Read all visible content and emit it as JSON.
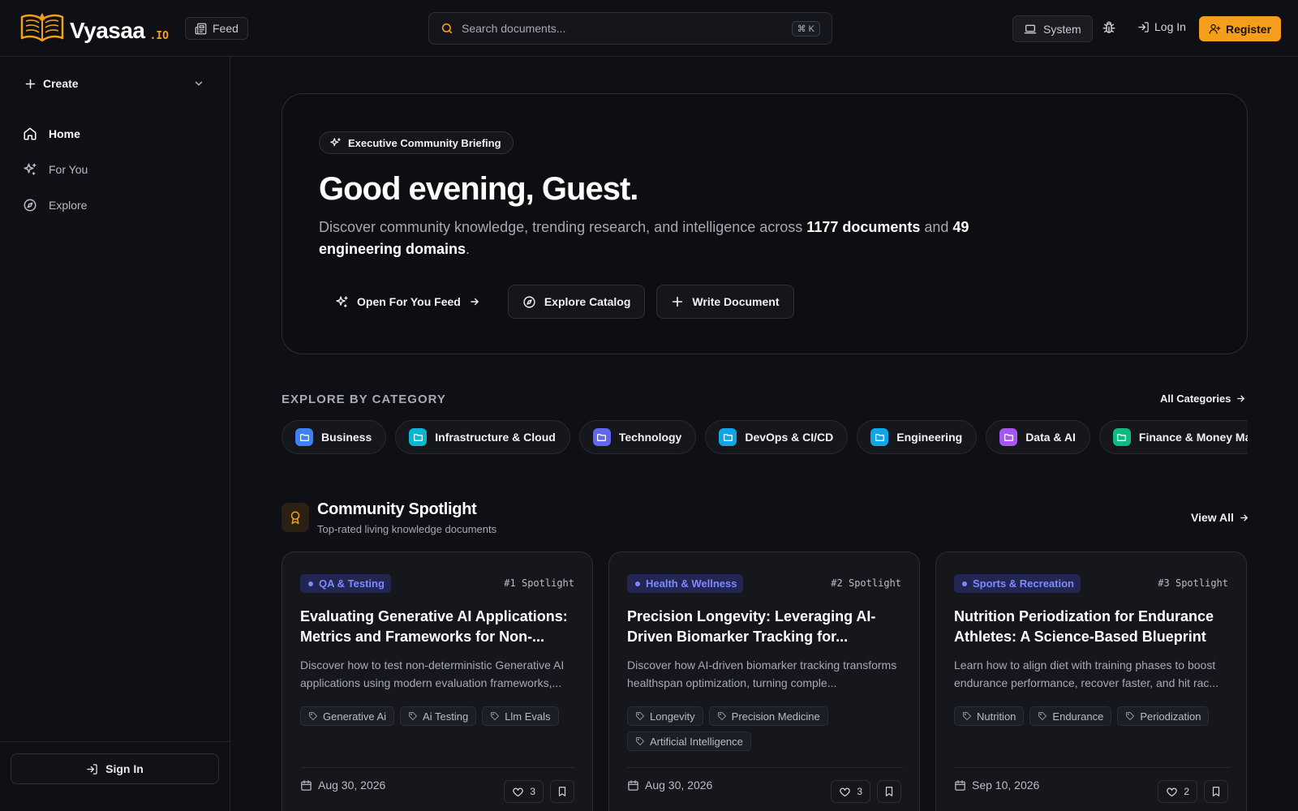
{
  "brand": {
    "name": "Vyasaa",
    "tld": ".IO"
  },
  "topbar": {
    "feed_label": "Feed",
    "search_placeholder": "Search documents...",
    "search_shortcut": "⌘ K",
    "theme_label": "System",
    "login_label": "Log In",
    "register_label": "Register"
  },
  "sidebar": {
    "create_label": "Create",
    "items": [
      {
        "label": "Home",
        "icon": "home-icon",
        "active": true
      },
      {
        "label": "For You",
        "icon": "sparkles-icon",
        "active": false
      },
      {
        "label": "Explore",
        "icon": "compass-icon",
        "active": false
      }
    ],
    "sign_in_label": "Sign In"
  },
  "hero": {
    "badge": "Executive Community Briefing",
    "greeting": "Good evening, Guest.",
    "lead_prefix": "Discover community knowledge, trending research, and intelligence across ",
    "documents_count": "1177 documents",
    "lead_mid": " and ",
    "domains_count": "49 engineering domains",
    "lead_suffix": ".",
    "actions": {
      "feed": "Open For You Feed",
      "explore": "Explore Catalog",
      "write": "Write Document"
    }
  },
  "categories": {
    "title": "EXPLORE BY CATEGORY",
    "all_label": "All Categories",
    "items": [
      {
        "label": "Business",
        "color": "#3b82f6"
      },
      {
        "label": "Infrastructure & Cloud",
        "color": "#06b6d4"
      },
      {
        "label": "Technology",
        "color": "#6366f1"
      },
      {
        "label": "DevOps & CI/CD",
        "color": "#0ea5e9"
      },
      {
        "label": "Engineering",
        "color": "#0ea5e9"
      },
      {
        "label": "Data & AI",
        "color": "#a855f7"
      },
      {
        "label": "Finance & Money Management",
        "color": "#10b981"
      }
    ]
  },
  "spotlight": {
    "title": "Community Spotlight",
    "subtitle": "Top-rated living knowledge documents",
    "view_all": "View All",
    "cards": [
      {
        "category": "QA & Testing",
        "rank": "#1 Spotlight",
        "title": "Evaluating Generative AI Applications: Metrics and Frameworks for Non-...",
        "description": "Discover how to test non-deterministic Generative AI applications using modern evaluation frameworks,...",
        "tags": [
          "Generative Ai",
          "Ai Testing",
          "Llm Evals"
        ],
        "date": "Aug 30, 2026",
        "likes": "3"
      },
      {
        "category": "Health & Wellness",
        "rank": "#2 Spotlight",
        "title": "Precision Longevity: Leveraging AI-Driven Biomarker Tracking for...",
        "description": "Discover how AI-driven biomarker tracking transforms healthspan optimization, turning comple...",
        "tags": [
          "Longevity",
          "Precision Medicine",
          "Artificial Intelligence"
        ],
        "date": "Aug 30, 2026",
        "likes": "3"
      },
      {
        "category": "Sports & Recreation",
        "rank": "#3 Spotlight",
        "title": "Nutrition Periodization for Endurance Athletes: A Science-Based Blueprint",
        "description": "Learn how to align diet with training phases to boost endurance performance, recover faster, and hit rac...",
        "tags": [
          "Nutrition",
          "Endurance",
          "Periodization"
        ],
        "date": "Sep 10, 2026",
        "likes": "2"
      }
    ]
  },
  "colors": {
    "accent": "#f59e1b",
    "tag_blue": "#7b8bff"
  }
}
